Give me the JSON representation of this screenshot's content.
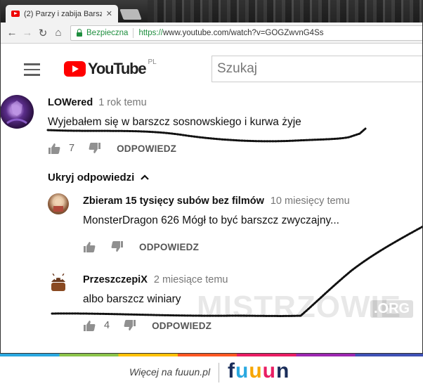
{
  "browser": {
    "tab_title": "(2) Parzy i zabija Barszcz",
    "tab_close": "✕",
    "secure_label": "Bezpieczna",
    "url_scheme": "https://",
    "url_rest": "www.youtube.com/watch?v=GOGZwvnG4Ss"
  },
  "youtube": {
    "logo_text": "YouTube",
    "region": "PL",
    "search_placeholder": "Szukaj"
  },
  "comments": {
    "main": {
      "author": "LOWered",
      "time": "1 rok temu",
      "text": "Wyjebałem się w barszcz sosnowskiego i kurwa żyje",
      "likes": "7",
      "reply_label": "ODPOWIEDZ"
    },
    "hide_replies": "Ukryj odpowiedzi",
    "replies": [
      {
        "author": "Zbieram 15 tysięcy subów bez filmów",
        "time": "10 miesięcy temu",
        "text": "MonsterDragon 626 Mógł to być barszcz zwyczajny...",
        "likes": "",
        "reply_label": "ODPOWIEDZ"
      },
      {
        "author": "PrzeszczepiX",
        "time": "2 miesiące temu",
        "text": "albo barszcz winiary",
        "likes": "4",
        "reply_label": "ODPOWIEDZ"
      }
    ]
  },
  "watermark": {
    "text": "MISTRZOWIE",
    "org": ".ORG"
  },
  "footer": {
    "text": "Więcej na fuuun.pl",
    "logo_letters": [
      "f",
      "u",
      "u",
      "u",
      "n"
    ]
  }
}
